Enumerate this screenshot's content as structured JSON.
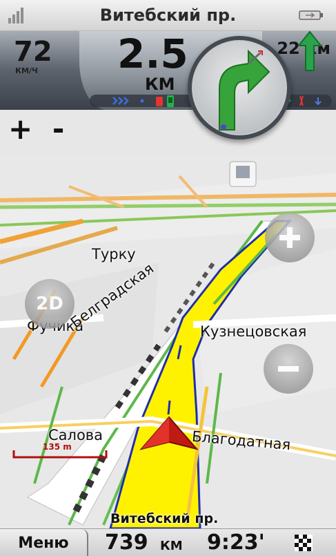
{
  "status_bar": {
    "current_street": "Витебский пр.",
    "icons": [
      "signal-icon",
      "battery-icon"
    ]
  },
  "instrument_panel": {
    "speed_value": "72",
    "speed_unit": "КМ/Ч",
    "turn_distance_value": "2.5",
    "turn_distance_unit": "КМ",
    "next_turn_distance": "22 км",
    "maneuver": "turn-right-icon",
    "next_maneuver": "straight-arrow-icon"
  },
  "zoom_controls": {
    "plus": "+",
    "minus": "-"
  },
  "map": {
    "labels": {
      "turku": "Турку",
      "fuchika": "Фучика",
      "belgradskaya": "Белградская",
      "kuznetsovskaya": "Кузнецовская",
      "salova": "Салова",
      "blagodatnaya": "Благодатная"
    },
    "view_mode": "2D",
    "scale": "135 m",
    "colors": {
      "route": "#fff200",
      "route_edge": "#1f2fa8",
      "traffic_green": "#5fbf2a",
      "traffic_orange": "#f19a25",
      "traffic_yellow": "#e8d11b",
      "position_marker": "#c01a14"
    }
  },
  "route_info": {
    "next_street": "Витебский пр."
  },
  "bottom_bar": {
    "menu_label": "Меню",
    "remaining_distance_value": "739",
    "remaining_distance_unit": "КМ",
    "eta": "9:23'"
  }
}
